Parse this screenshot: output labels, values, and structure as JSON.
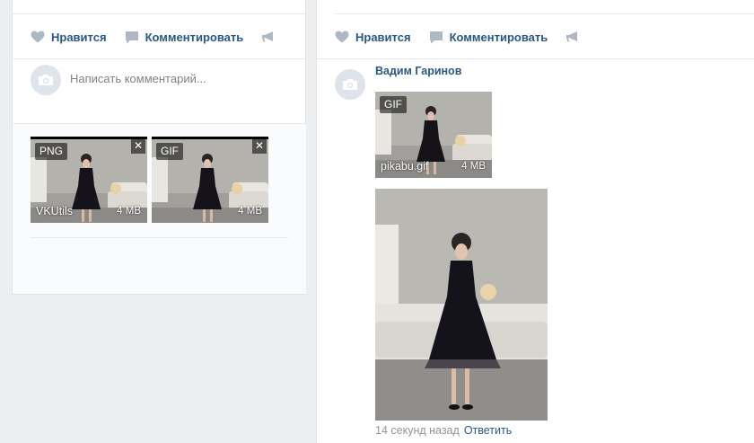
{
  "left_post": {
    "actions": {
      "like_label": "Нравится",
      "comment_label": "Комментировать",
      "share_icon": "megaphone-icon"
    },
    "comment_box": {
      "placeholder": "Написать комментарий...",
      "avatar_icon": "camera-icon"
    },
    "attachments": [
      {
        "type_badge": "PNG",
        "name": "VKUtils",
        "size": "4 MB",
        "close_label": "✕"
      },
      {
        "type_badge": "GIF",
        "name": "",
        "size": "4 MB",
        "close_label": "✕"
      }
    ]
  },
  "right_post": {
    "actions": {
      "like_label": "Нравится",
      "comment_label": "Комментировать",
      "share_icon": "megaphone-icon"
    },
    "comment": {
      "author": "Вадим Гаринов",
      "avatar_icon": "camera-icon",
      "doc_attachment": {
        "type_badge": "GIF",
        "name": "pikabu.gif",
        "size": "4 MB"
      },
      "time": "14 секунд назад",
      "reply_label": "Ответить"
    }
  },
  "colors": {
    "link": "#2a5885",
    "muted_text": "#828282",
    "icon_gray": "#aeb7c2",
    "page_background": "#edeef0"
  }
}
